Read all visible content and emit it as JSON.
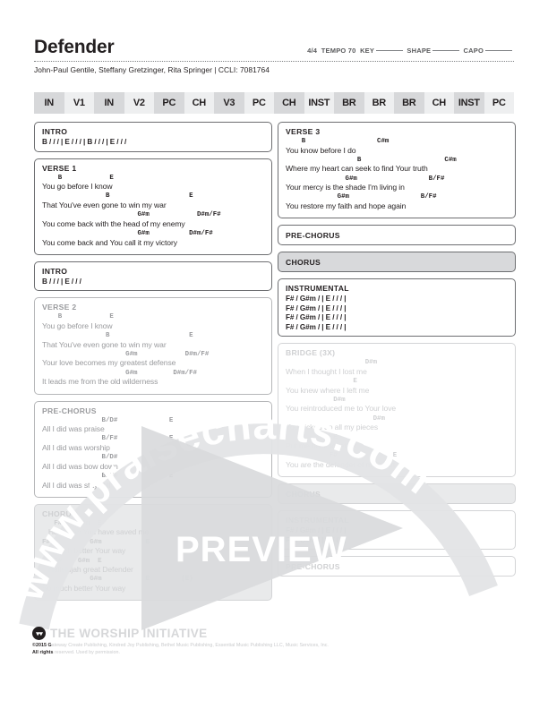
{
  "header": {
    "title": "Defender",
    "meta": {
      "time_signature": "4/4",
      "tempo_label": "TEMPO",
      "tempo_value": "70",
      "key_label": "KEY",
      "shape_label": "SHAPE",
      "capo_label": "CAPO"
    },
    "credits": "John-Paul Gentile, Steffany Gretzinger, Rita Springer | CCLI: 7081764"
  },
  "structure": [
    {
      "label": "IN",
      "shade": "dark"
    },
    {
      "label": "V1",
      "shade": "light"
    },
    {
      "label": "IN",
      "shade": "dark"
    },
    {
      "label": "V2",
      "shade": "light"
    },
    {
      "label": "PC",
      "shade": "dark"
    },
    {
      "label": "CH",
      "shade": "light"
    },
    {
      "label": "V3",
      "shade": "dark"
    },
    {
      "label": "PC",
      "shade": "light"
    },
    {
      "label": "CH",
      "shade": "dark"
    },
    {
      "label": "INST",
      "shade": "light"
    },
    {
      "label": "BR",
      "shade": "dark"
    },
    {
      "label": "BR",
      "shade": "light"
    },
    {
      "label": "BR",
      "shade": "dark"
    },
    {
      "label": "CH",
      "shade": "light"
    },
    {
      "label": "INST",
      "shade": "dark"
    },
    {
      "label": "PC",
      "shade": "light"
    }
  ],
  "left_column": {
    "intro1": {
      "label": "INTRO",
      "progression": "B / / / | E / / / | B / / / | E / / /"
    },
    "verse1": {
      "label": "VERSE 1",
      "lines": [
        {
          "chords": "    B            E",
          "lyric": "You go before I know"
        },
        {
          "chords": "                B                    E",
          "lyric": "That You've even gone to win my war"
        },
        {
          "chords": "                        G#m            D#m/F#",
          "lyric": "You come back with the head of my enemy"
        },
        {
          "chords": "                        G#m          D#m/F#",
          "lyric": "You come back and You call it my victory"
        }
      ]
    },
    "intro2": {
      "label": "INTRO",
      "progression": "B / / / | E / / /"
    },
    "verse2": {
      "label": "VERSE 2",
      "lines": [
        {
          "chords": "    B            E",
          "lyric": "You go before I know"
        },
        {
          "chords": "                B                    E",
          "lyric": "That You've even gone to win my war"
        },
        {
          "chords": "                     G#m            D#m/F#",
          "lyric": "Your love becomes my greatest defense"
        },
        {
          "chords": "                     G#m         D#m/F#",
          "lyric": "It leads me from the old wilderness"
        }
      ]
    },
    "prechorus": {
      "label": "PRE-CHORUS",
      "lines": [
        {
          "chords": "               B/D#             E",
          "lyric": "All I did was praise"
        },
        {
          "chords": "               B/F#             E",
          "lyric": "All I did was worship"
        },
        {
          "chords": "               B/D#             E",
          "lyric": "All I did was bow down"
        },
        {
          "chords": "               B/F#             E",
          "lyric": "All I did was stay still"
        }
      ]
    },
    "chorus": {
      "label": "CHORUS",
      "lines": [
        {
          "chords": "   F#    G#m  E",
          "lyric": "   Hallelujah You have saved me"
        },
        {
          "chords": "F#          G#m           E",
          "lyric": "So much better Your way"
        },
        {
          "chords": "   F#    G#m  E",
          "lyric": "   Hallelujah great Defender"
        },
        {
          "chords": "F#          G#m           E        (E)",
          "lyric": "So much better Your way"
        }
      ]
    }
  },
  "right_column": {
    "verse3": {
      "label": "VERSE 3",
      "lines": [
        {
          "chords": "    B                  C#m",
          "lyric": "You know before I do"
        },
        {
          "chords": "                  B                     C#m",
          "lyric": "Where my heart can seek to find Your truth"
        },
        {
          "chords": "               G#m                  B/F#",
          "lyric": "Your mercy is the shade I'm living in"
        },
        {
          "chords": "             G#m                  B/F#",
          "lyric": "You restore my faith and hope again"
        }
      ]
    },
    "prechorus1": {
      "label": "PRE-CHORUS"
    },
    "chorus1": {
      "label": "CHORUS"
    },
    "instrumental1": {
      "label": "INSTRUMENTAL",
      "lines": [
        "F# / G#m / | E / / / |",
        "F# / G#m / | E / / / |",
        "F# / G#m / | E / / / |",
        "F# / G#m / | E / / / |"
      ]
    },
    "bridge": {
      "label": "BRIDGE (3X)",
      "lines": [
        {
          "chords": "                    D#m",
          "lyric": "When I thought I lost me"
        },
        {
          "chords": "                 E",
          "lyric": "You knew where I left me"
        },
        {
          "chords": "            D#m",
          "lyric": "You reintroduced me to Your love"
        },
        {
          "chords": "                      D#m",
          "lyric": "You picked up all my pieces"
        },
        {
          "chords": "            E",
          "lyric": "Put me back together"
        },
        {
          "chords": "           F#              E",
          "lyric": "You are the defender of my heart"
        }
      ]
    },
    "chorus2": {
      "label": "CHORUS"
    },
    "instrumental2": {
      "label": "INSTRUMENTAL",
      "lines": [
        "F# / G#m / | E / / / |",
        "F# / G#m / | E / / / |"
      ]
    },
    "prechorus2": {
      "label": "PRE-CHORUS"
    }
  },
  "overlay": {
    "watermark_text": "www.praisecharts.com",
    "preview_text": "PREVIEW",
    "play_icon": "play-triangle-icon"
  },
  "footer": {
    "brand": "THE WORSHIP INITIATIVE",
    "brand_icon": "worship-initiative-logo",
    "copyright_bold": "©2015 G",
    "copyright_line1": "ateway Create Publishing, Kindred Joy Publishing, Bethel Music Publishing, Essential Music Publishing LLC, Music Services, Inc.",
    "copyright_line2_bold": "All rights",
    "copyright_line2": " reserved. Used by permission."
  },
  "colors": {
    "ink": "#231f20",
    "rule": "#6d6e71",
    "fill": "#d8d9db",
    "struct_dark": "#d7d8da",
    "struct_light": "#eeeff0",
    "faded": "#cfd0d2"
  }
}
